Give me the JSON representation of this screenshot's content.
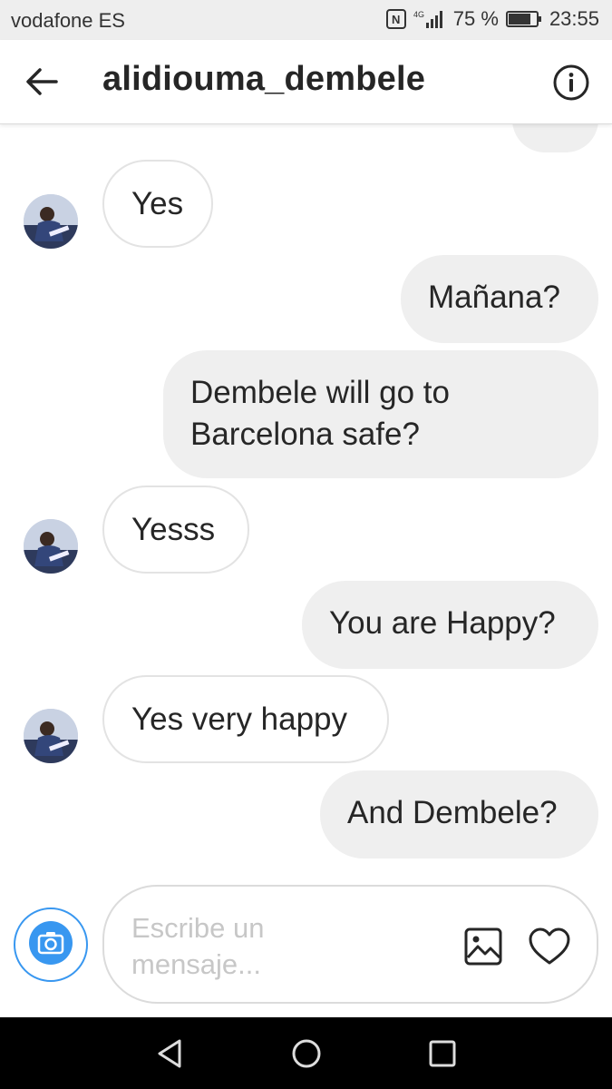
{
  "status_bar": {
    "carrier": "vodafone ES",
    "network": "4G",
    "battery": "75 %",
    "time": "23:55"
  },
  "header": {
    "title": "alidiouma_dembele"
  },
  "messages": [
    {
      "side": "in",
      "text": "Yes"
    },
    {
      "side": "out",
      "text": "Mañana?"
    },
    {
      "side": "out",
      "text": "Dembele will go to Barcelona safe?"
    },
    {
      "side": "in",
      "text": "Yesss"
    },
    {
      "side": "out",
      "text": "You are Happy?"
    },
    {
      "side": "in",
      "text": "Yes very happy"
    },
    {
      "side": "out",
      "text": "And Dembele?"
    }
  ],
  "composer": {
    "placeholder": "Escribe un mensaje..."
  },
  "colors": {
    "accent": "#3897f0",
    "outgoing_bubble": "#efefef",
    "incoming_border": "#e3e3e3",
    "text": "#262626"
  },
  "icons": [
    "back-arrow-icon",
    "info-icon",
    "camera-icon",
    "gallery-icon",
    "heart-icon",
    "nav-back-icon",
    "nav-home-icon",
    "nav-recents-icon"
  ]
}
